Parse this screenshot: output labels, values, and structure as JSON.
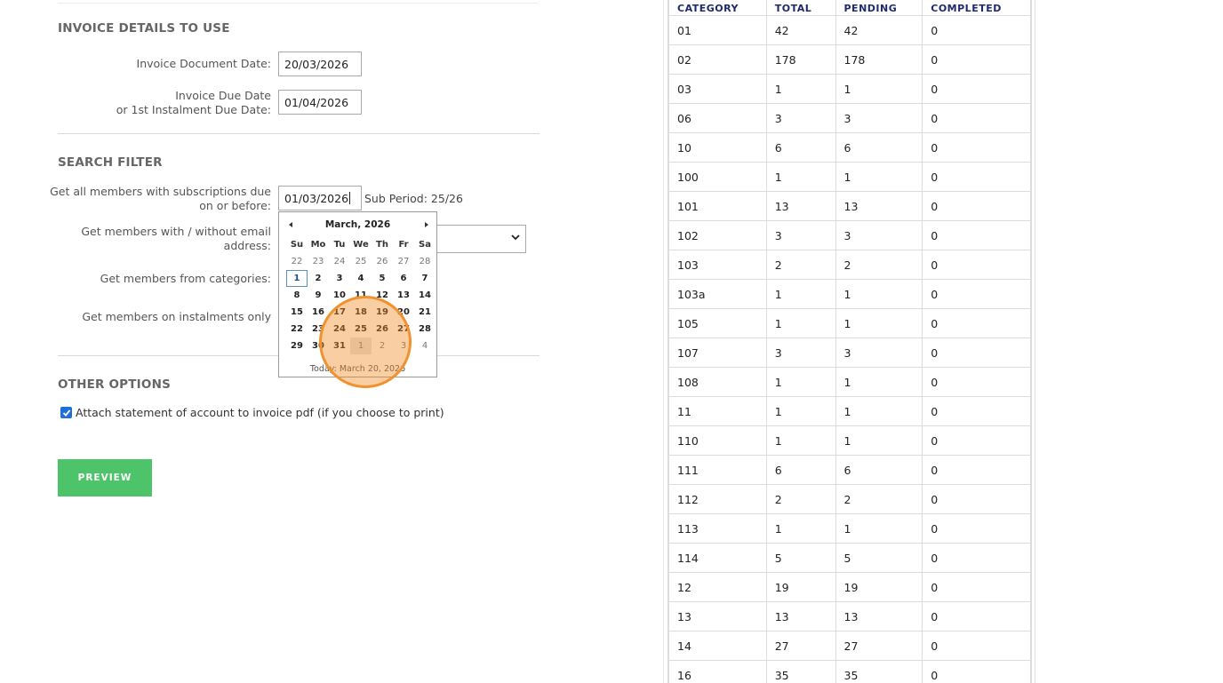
{
  "sections": {
    "invoice_details": "INVOICE DETAILS TO USE",
    "search_filter": "SEARCH FILTER",
    "other_options": "OTHER OPTIONS"
  },
  "invoice": {
    "doc_date_label": "Invoice Document Date:",
    "doc_date_value": "20/03/2026",
    "due_date_label_1": "Invoice Due Date",
    "due_date_label_2": "or 1st Instalment Due Date:",
    "due_date_value": "01/04/2026"
  },
  "filter": {
    "subs_label_1": "Get all members with subscriptions due",
    "subs_label_2": "on or before:",
    "subs_value": "01/03/2026",
    "sub_period": "Sub Period: 25/26",
    "email_label_1": "Get members with / without email",
    "email_label_2": "address:",
    "categories_label": "Get members from categories:",
    "instalments_label": "Get members on instalments only"
  },
  "calendar": {
    "title": "March, 2026",
    "weekdays": [
      "Su",
      "Mo",
      "Tu",
      "We",
      "Th",
      "Fr",
      "Sa"
    ],
    "weeks": [
      [
        "22",
        "23",
        "24",
        "25",
        "26",
        "27",
        "28"
      ],
      [
        "1",
        "2",
        "3",
        "4",
        "5",
        "6",
        "7"
      ],
      [
        "8",
        "9",
        "10",
        "11",
        "12",
        "13",
        "14"
      ],
      [
        "15",
        "16",
        "17",
        "18",
        "19",
        "20",
        "21"
      ],
      [
        "22",
        "23",
        "24",
        "25",
        "26",
        "27",
        "28"
      ],
      [
        "29",
        "30",
        "31",
        "1",
        "2",
        "3",
        "4"
      ]
    ],
    "today_text": "Today: March 20, 2026"
  },
  "options": {
    "attach_statement_label": "Attach statement of account to invoice pdf (if you choose to print)",
    "attach_statement_checked": true
  },
  "buttons": {
    "preview": "PREVIEW"
  },
  "table": {
    "headers": [
      "CATEGORY",
      "TOTAL",
      "PENDING",
      "COMPLETED"
    ],
    "rows": [
      [
        "01",
        "42",
        "42",
        "0"
      ],
      [
        "02",
        "178",
        "178",
        "0"
      ],
      [
        "03",
        "1",
        "1",
        "0"
      ],
      [
        "06",
        "3",
        "3",
        "0"
      ],
      [
        "10",
        "6",
        "6",
        "0"
      ],
      [
        "100",
        "1",
        "1",
        "0"
      ],
      [
        "101",
        "13",
        "13",
        "0"
      ],
      [
        "102",
        "3",
        "3",
        "0"
      ],
      [
        "103",
        "2",
        "2",
        "0"
      ],
      [
        "103a",
        "1",
        "1",
        "0"
      ],
      [
        "105",
        "1",
        "1",
        "0"
      ],
      [
        "107",
        "3",
        "3",
        "0"
      ],
      [
        "108",
        "1",
        "1",
        "0"
      ],
      [
        "11",
        "1",
        "1",
        "0"
      ],
      [
        "110",
        "1",
        "1",
        "0"
      ],
      [
        "111",
        "6",
        "6",
        "0"
      ],
      [
        "112",
        "2",
        "2",
        "0"
      ],
      [
        "113",
        "1",
        "1",
        "0"
      ],
      [
        "114",
        "5",
        "5",
        "0"
      ],
      [
        "12",
        "19",
        "19",
        "0"
      ],
      [
        "13",
        "13",
        "13",
        "0"
      ],
      [
        "14",
        "27",
        "27",
        "0"
      ],
      [
        "16",
        "35",
        "35",
        "0"
      ]
    ]
  },
  "colors": {
    "preview_button": "#4ec46a",
    "highlight": "#f0922e",
    "table_header_text": "#1d2a6e"
  }
}
